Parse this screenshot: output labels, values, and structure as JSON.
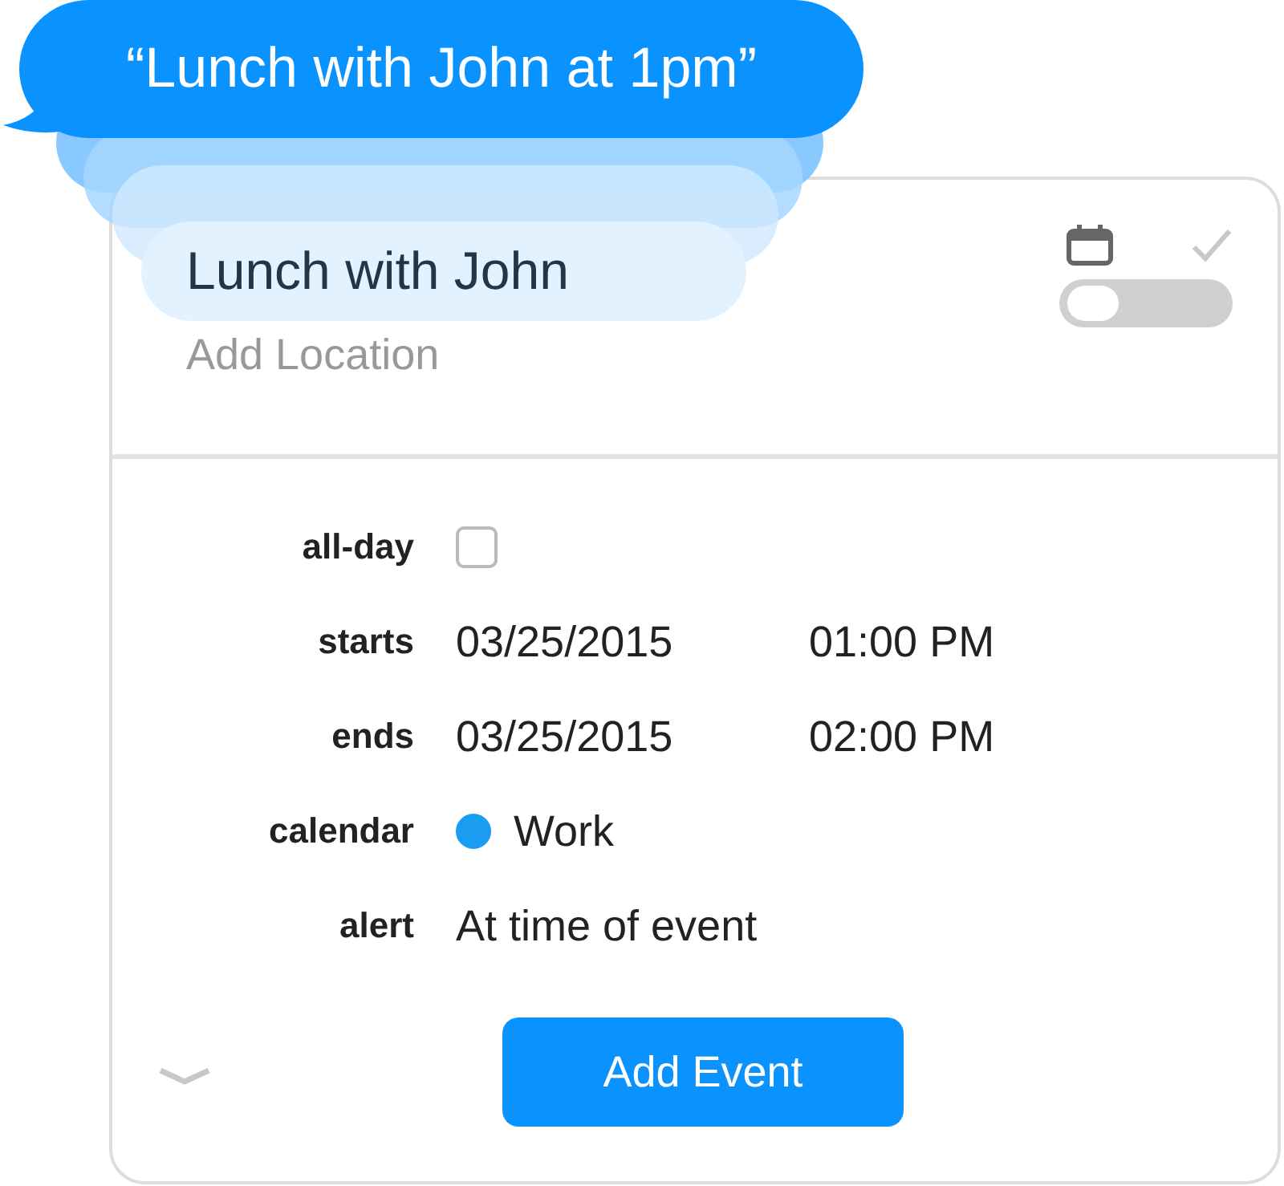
{
  "bubble": {
    "text": "“Lunch with John at 1pm”"
  },
  "event": {
    "title": "Lunch with John",
    "location_placeholder": "Add Location",
    "toggle_on": false
  },
  "fields": [
    {
      "kind": "checkbox",
      "label": "all-day",
      "checked": false
    },
    {
      "kind": "datetime",
      "label": "starts",
      "date": "03/25/2015",
      "time": "01:00 PM"
    },
    {
      "kind": "datetime",
      "label": "ends",
      "date": "03/25/2015",
      "time": "02:00 PM"
    },
    {
      "kind": "calendar",
      "label": "calendar",
      "value": "Work",
      "color": "#1a9cf0"
    },
    {
      "kind": "text",
      "label": "alert",
      "value": "At time of event"
    }
  ],
  "button": "Add Event"
}
